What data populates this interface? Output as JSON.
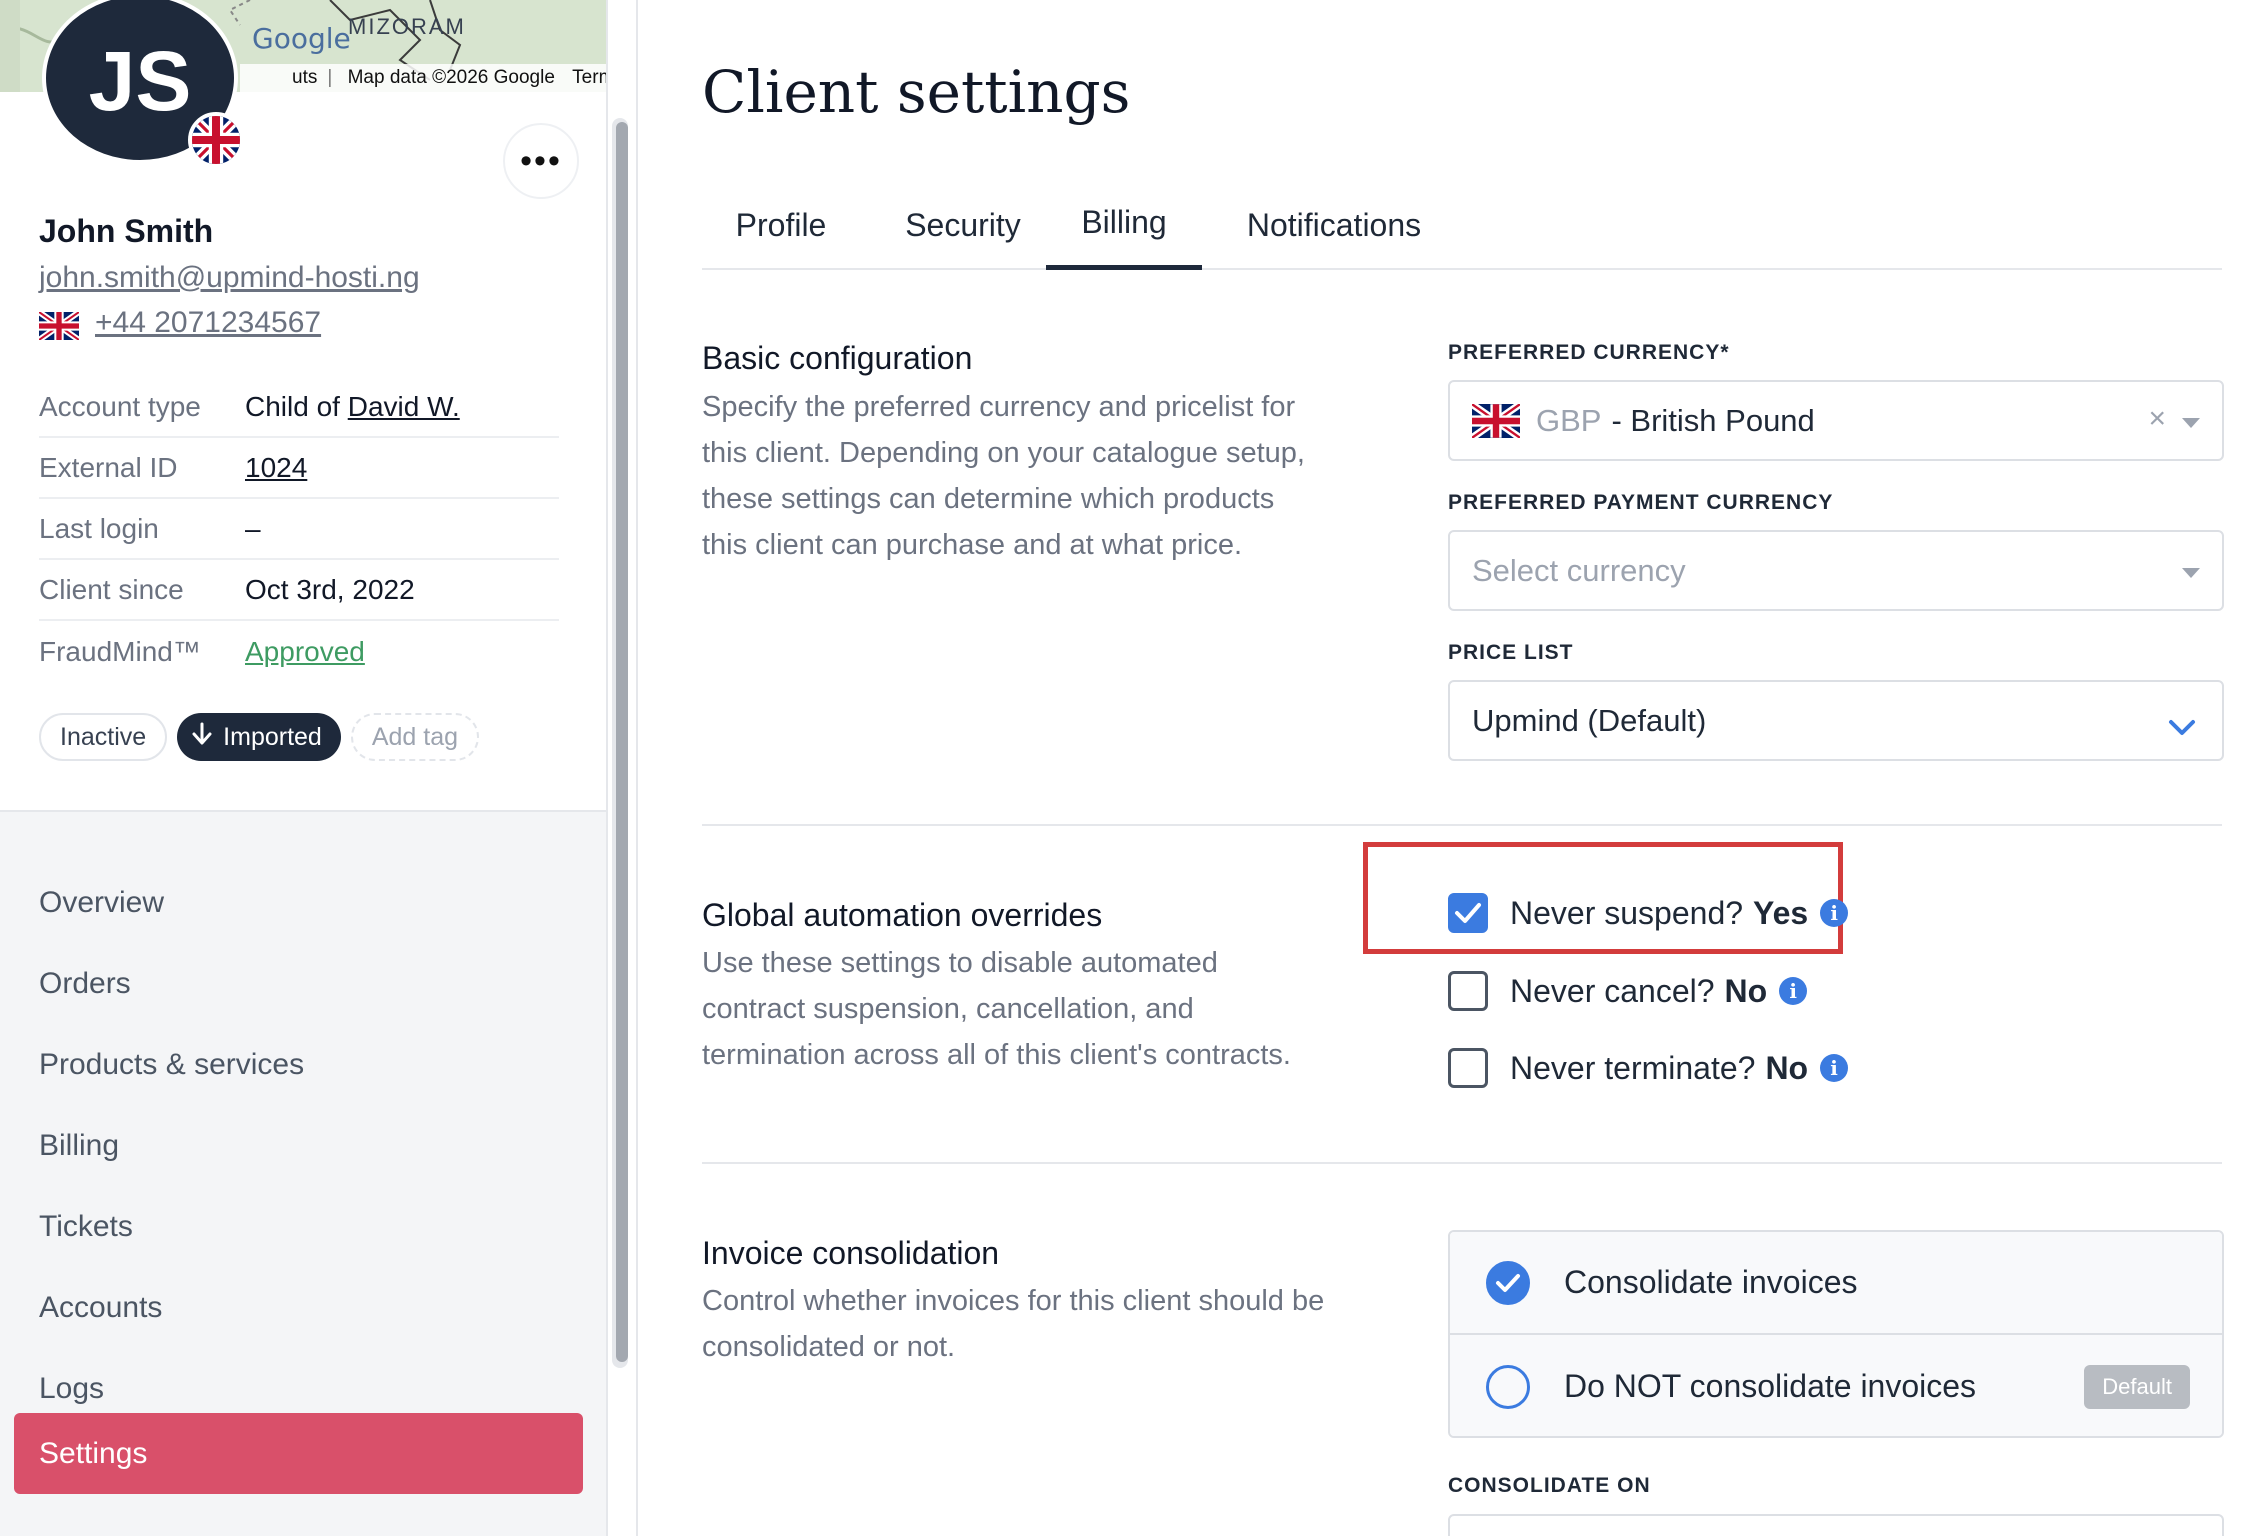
{
  "map": {
    "google_label": "Google",
    "place_label": "MIZORAM",
    "attribution_left": "uts",
    "attribution": "Map data ©2026 Google",
    "terms": "Terms"
  },
  "client": {
    "initials": "JS",
    "name": "John Smith",
    "email": "john.smith@upmind-hosti.ng",
    "phone": "+44 2071234567",
    "more_label": "•••"
  },
  "meta": [
    {
      "label": "Account type",
      "prefix": "Child of ",
      "value": "David W."
    },
    {
      "label": "External ID",
      "value": "1024"
    },
    {
      "label": "Last login",
      "value": "–"
    },
    {
      "label": "Client since",
      "value": "Oct 3rd, 2022"
    },
    {
      "label": "FraudMind™",
      "value": "Approved"
    }
  ],
  "tags": {
    "inactive": "Inactive",
    "imported": "Imported",
    "add": "Add tag"
  },
  "nav": {
    "items": [
      "Overview",
      "Orders",
      "Products & services",
      "Billing",
      "Tickets",
      "Accounts",
      "Logs",
      "Settings"
    ],
    "active": "Settings"
  },
  "page": {
    "title": "Client settings",
    "tabs": [
      "Profile",
      "Security",
      "Billing",
      "Notifications"
    ],
    "active_tab": "Billing"
  },
  "basic": {
    "title": "Basic configuration",
    "description": [
      "Specify the preferred currency and pricelist for",
      "this client. Depending on your catalogue setup,",
      "these settings can determine which products",
      "this client can purchase and at what price."
    ],
    "preferred_currency_label": "PREFERRED CURRENCY*",
    "preferred_currency_code": "GBP",
    "preferred_currency_name": "- British Pound",
    "payment_currency_label": "PREFERRED PAYMENT CURRENCY",
    "payment_currency_placeholder": "Select currency",
    "price_list_label": "PRICE LIST",
    "price_list_value": "Upmind (Default)"
  },
  "automation": {
    "title": "Global automation overrides",
    "description": [
      "Use these settings to disable automated",
      "contract suspension, cancellation, and",
      "termination across all of this client's contracts."
    ],
    "options": [
      {
        "label": "Never suspend?",
        "value": "Yes",
        "checked": true
      },
      {
        "label": "Never cancel?",
        "value": "No",
        "checked": false
      },
      {
        "label": "Never terminate?",
        "value": "No",
        "checked": false
      }
    ]
  },
  "invoice": {
    "title": "Invoice consolidation",
    "description": [
      "Control whether invoices for this client should be",
      "consolidated or not."
    ],
    "options": [
      {
        "label": "Consolidate invoices",
        "selected": true
      },
      {
        "label": "Do NOT consolidate invoices",
        "selected": false,
        "badge": "Default"
      }
    ],
    "consolidate_on_label": "CONSOLIDATE ON"
  },
  "colors": {
    "accent_nav": "#d9506a",
    "primary_blue": "#3b7be0",
    "dark": "#1e293b",
    "highlight_red": "#d33c3c",
    "approved_green": "#3e9b62"
  }
}
